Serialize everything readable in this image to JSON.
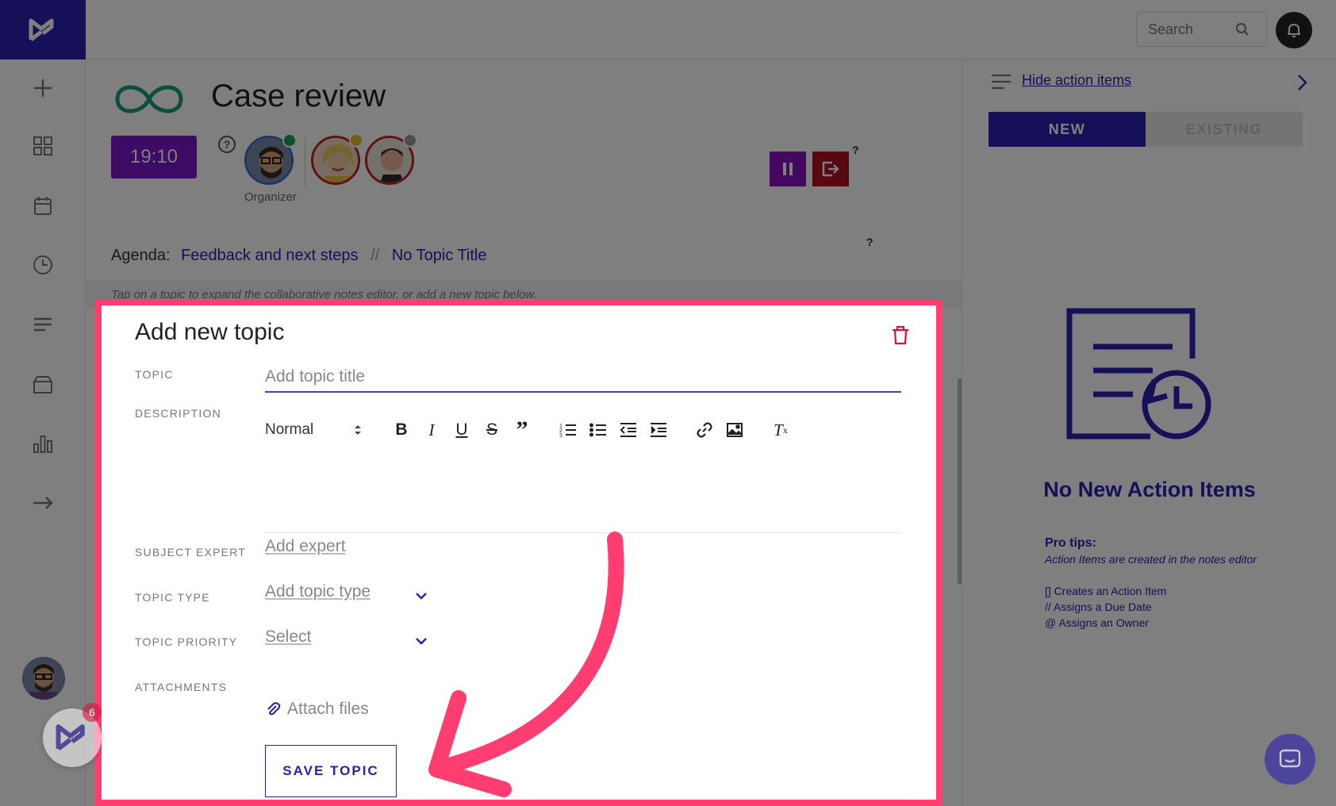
{
  "topbar": {
    "search_placeholder": "Search"
  },
  "meeting": {
    "title": "Case review",
    "timer": "19:10",
    "organizer_label": "Organizer",
    "help": "?"
  },
  "agenda": {
    "label": "Agenda:",
    "crumb1": "Feedback and next steps",
    "separator": "//",
    "crumb2": "No Topic Title",
    "help": "?"
  },
  "tip": "Tap on a topic to expand the collaborative notes editor, or add a new topic below.",
  "form": {
    "title": "Add new topic",
    "topic_label": "TOPIC",
    "topic_placeholder": "Add topic title",
    "description_label": "DESCRIPTION",
    "format_select": "Normal",
    "subject_expert_label": "SUBJECT EXPERT",
    "subject_expert_value": "Add expert",
    "topic_type_label": "TOPIC TYPE",
    "topic_type_value": "Add topic type",
    "priority_label": "TOPIC PRIORITY",
    "priority_value": "Select",
    "attachments_label": "ATTACHMENTS",
    "attach_text": "Attach files",
    "save_label": "SAVE TOPIC"
  },
  "right_panel": {
    "hide_link": "Hide action items",
    "tab_new": "NEW",
    "tab_existing": "EXISTING",
    "empty_title": "No New Action Items",
    "pro_tips_heading": "Pro tips:",
    "pro_tips_sub": "Action Items are created in the notes editor",
    "tip1": "[] Creates an Action Item",
    "tip2": "// Assigns a Due Date",
    "tip3": "@ Assigns an Owner"
  },
  "badge_count": "6",
  "colors": {
    "brand": "#2a20b0",
    "timer": "#7a14c8",
    "highlight": "#ff3d71",
    "end_button": "#b0101c"
  }
}
